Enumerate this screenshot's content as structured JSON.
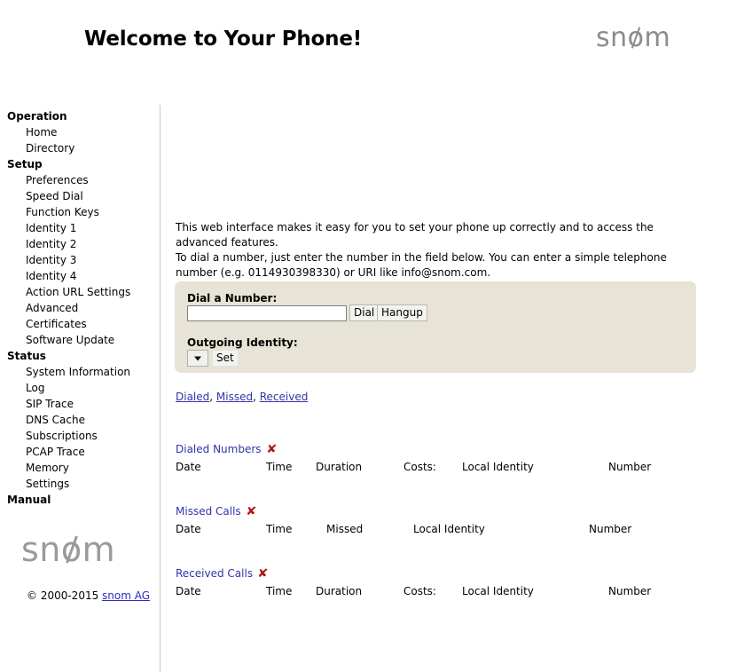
{
  "header": {
    "title": "Welcome to Your Phone!",
    "logo_text": "snom"
  },
  "sidebar": {
    "logo_text": "snom",
    "copyright_prefix": "© 2000-2015 ",
    "copyright_link": "snom AG",
    "groups": [
      {
        "title": "Operation",
        "items": [
          "Home",
          "Directory"
        ]
      },
      {
        "title": "Setup",
        "items": [
          "Preferences",
          "Speed Dial",
          "Function Keys",
          "Identity 1",
          "Identity 2",
          "Identity 3",
          "Identity 4",
          "Action URL Settings",
          "Advanced",
          "Certificates",
          "Software Update"
        ]
      },
      {
        "title": "Status",
        "items": [
          "System Information",
          "Log",
          "SIP Trace",
          "DNS Cache",
          "Subscriptions",
          "PCAP Trace",
          "Memory",
          "Settings"
        ]
      },
      {
        "title": "Manual",
        "items": []
      }
    ]
  },
  "main": {
    "intro_line1": "This web interface makes it easy for you to set your phone up correctly and to access the advanced features.",
    "intro_line2": "To dial a number, just enter the number in the field below. You can enter a simple telephone number (e.g. 0114930398330) or URI like info@snom.com.",
    "dial_panel": {
      "dial_label": "Dial a Number:",
      "dial_input_value": "",
      "dial_input_placeholder": "",
      "dial_button": "Dial",
      "hangup_button": "Hangup",
      "identity_label": "Outgoing Identity:",
      "identity_selected": "",
      "identity_options": [],
      "set_button": "Set"
    },
    "quick_links": {
      "dialed": "Dialed",
      "missed": "Missed",
      "received": "Received",
      "separator": ", "
    },
    "call_lists": [
      {
        "title": "Dialed Numbers",
        "delete_icon": "✘",
        "columns": [
          "Date",
          "Time",
          "Duration",
          "Costs:",
          "Local Identity",
          "Number"
        ],
        "column_x": [
          0,
          102,
          158,
          257,
          323,
          488
        ],
        "rows": []
      },
      {
        "title": "Missed Calls",
        "delete_icon": "✘",
        "columns": [
          "Date",
          "Time",
          "Missed",
          "Local Identity",
          "Number"
        ],
        "column_x": [
          0,
          102,
          170,
          268,
          466
        ],
        "rows": []
      },
      {
        "title": "Received Calls",
        "delete_icon": "✘",
        "columns": [
          "Date",
          "Time",
          "Duration",
          "Costs:",
          "Local Identity",
          "Number"
        ],
        "column_x": [
          0,
          102,
          158,
          257,
          323,
          488
        ],
        "rows": []
      }
    ]
  }
}
